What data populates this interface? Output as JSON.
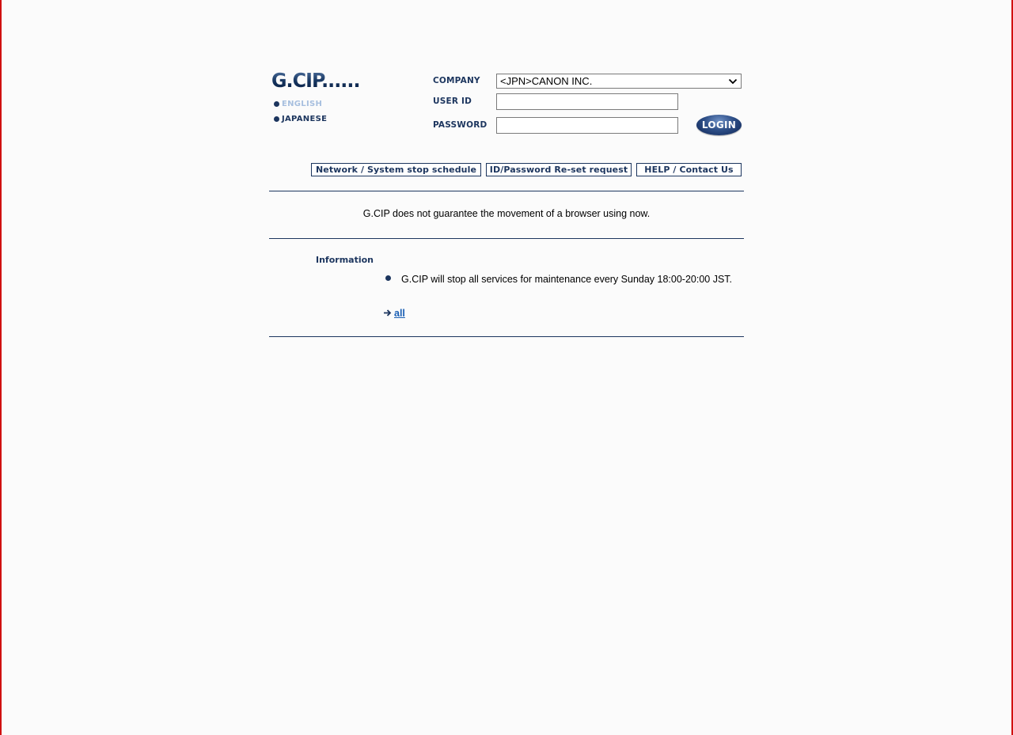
{
  "logo": {
    "text": "G.CIP......"
  },
  "languages": {
    "english": "ENGLISH",
    "japanese": "JAPANESE"
  },
  "login_form": {
    "company_label": "COMPANY",
    "company_value": "<JPN>CANON INC.",
    "userid_label": "USER ID",
    "userid_value": "",
    "password_label": "PASSWORD",
    "password_value": "",
    "login_button": "LOGIN"
  },
  "links": {
    "network": "Network / System stop schedule",
    "reset": "ID/Password Re-set request",
    "help": "HELP / Contact Us"
  },
  "notice": "G.CIP does not guarantee the movement of a browser using now.",
  "information": {
    "heading": "Information",
    "items": [
      {
        "text": "G.CIP will stop all services for maintenance every Sunday 18:00-20:00 JST."
      }
    ],
    "all_link": "all"
  },
  "colors": {
    "navy": "#1c355e",
    "english_inactive": "#a7bfdf",
    "link_blue": "#1a5fb4",
    "frame_red": "#d01010"
  },
  "icons": {
    "bullet": "bullet-icon",
    "arrow": "arrow-right-icon",
    "select_chevron": "chevron-down-icon"
  }
}
